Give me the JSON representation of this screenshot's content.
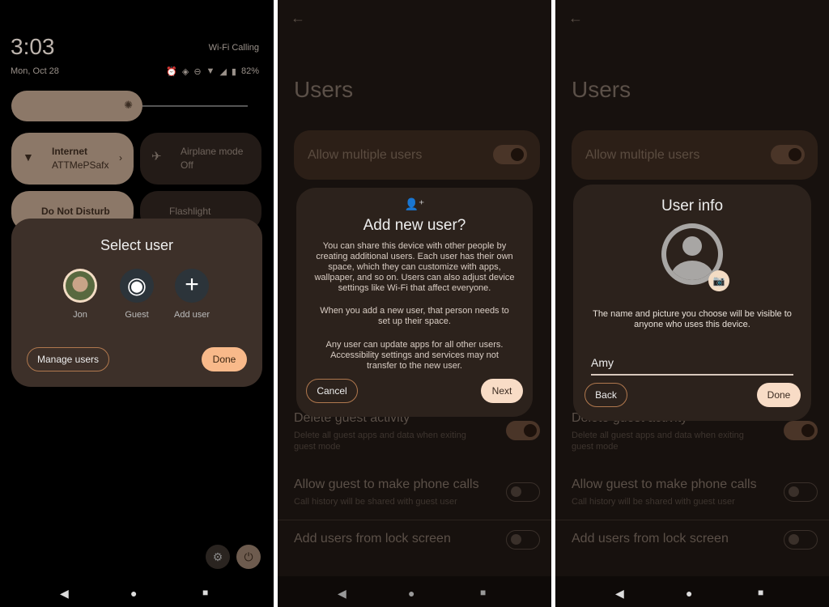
{
  "panel1": {
    "time": "3:03",
    "date": "Mon, Oct 28",
    "carrier": "Wi-Fi Calling",
    "battery": "82%",
    "status_icons": [
      "alarm-icon",
      "vibrate-icon",
      "dnd-icon",
      "wifi-icon",
      "signal-icon",
      "battery-icon"
    ],
    "tiles": [
      {
        "title": "Internet",
        "sub": "ATTMePSafx",
        "icon": "wifi-icon",
        "active": true
      },
      {
        "title": "Airplane mode",
        "sub": "Off",
        "icon": "airplane-icon",
        "active": false
      },
      {
        "title": "Do Not Disturb",
        "sub": "",
        "icon": "dnd-icon",
        "active": true
      },
      {
        "title": "Flashlight",
        "sub": "",
        "icon": "flashlight-icon",
        "active": false
      }
    ],
    "dialog": {
      "title": "Select user",
      "users": [
        {
          "label": "Jon"
        },
        {
          "label": "Guest"
        },
        {
          "label": "Add user"
        }
      ],
      "manage": "Manage users",
      "done": "Done"
    }
  },
  "settings": {
    "title": "Users",
    "allow_multiple": "Allow multiple users",
    "allow_multiple_on": true,
    "rows": [
      {
        "title": "Delete guest activity",
        "sub": "Delete all guest apps and data when exiting guest mode",
        "on": true
      },
      {
        "title": "Allow guest to make phone calls",
        "sub": "Call history will be shared with guest user",
        "on": false
      },
      {
        "title": "Add users from lock screen",
        "sub": "",
        "on": false
      }
    ]
  },
  "panel2": {
    "dialog": {
      "title": "Add new user?",
      "p1": "You can share this device with other people by creating additional users. Each user has their own space, which they can customize with apps, wallpaper, and so on. Users can also adjust device settings like Wi-Fi that affect everyone.",
      "p2": "When you add a new user, that person needs to set up their space.",
      "p3": "Any user can update apps for all other users. Accessibility settings and services may not transfer to the new user.",
      "cancel": "Cancel",
      "next": "Next"
    }
  },
  "panel3": {
    "dialog": {
      "title": "User info",
      "desc": "The name and picture you choose will be visible to anyone who uses this device.",
      "name_value": "Amy",
      "back": "Back",
      "done": "Done"
    }
  },
  "nav": {
    "back": "◀",
    "home": "●",
    "recents": "■"
  },
  "colors": {
    "accent": "#f8b98a",
    "surface": "#3d3029",
    "button_light": "#f8dcc6"
  }
}
